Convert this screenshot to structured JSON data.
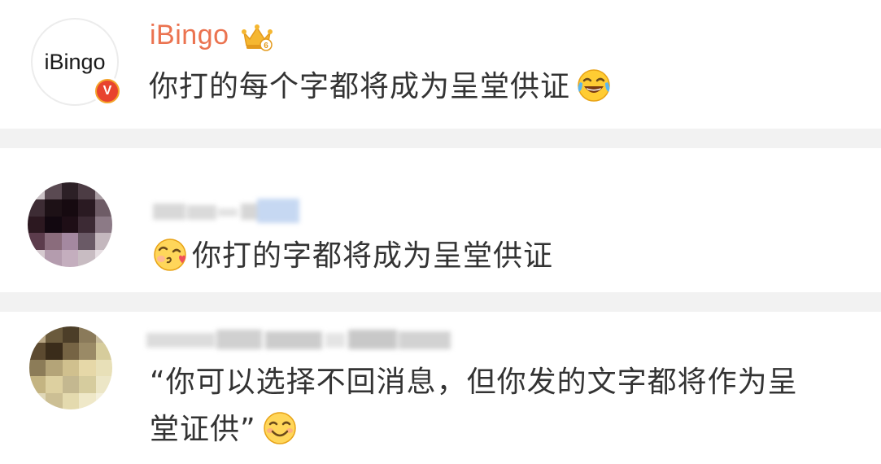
{
  "comments": [
    {
      "username": "iBingo",
      "avatar_text": "iBingo",
      "verified_badge": "V",
      "vip_level": "6",
      "text": "你打的每个字都将成为呈堂供证",
      "emoji": "laugh-cry-emoji"
    },
    {
      "username_blurred": true,
      "text": "你打的字都将成为呈堂供证",
      "emoji": "blowing-kiss-emoji"
    },
    {
      "username_blurred": true,
      "text_line1": "“你可以选择不回消息，但你发的文字都将作为呈",
      "text_line2": "堂证供”",
      "emoji": "grinning-emoji"
    }
  ],
  "colors": {
    "username": "#eb7350",
    "text": "#333333",
    "separator": "#f2f2f2",
    "badge_outer": "#f4a32b",
    "badge_inner": "#e8432e"
  }
}
